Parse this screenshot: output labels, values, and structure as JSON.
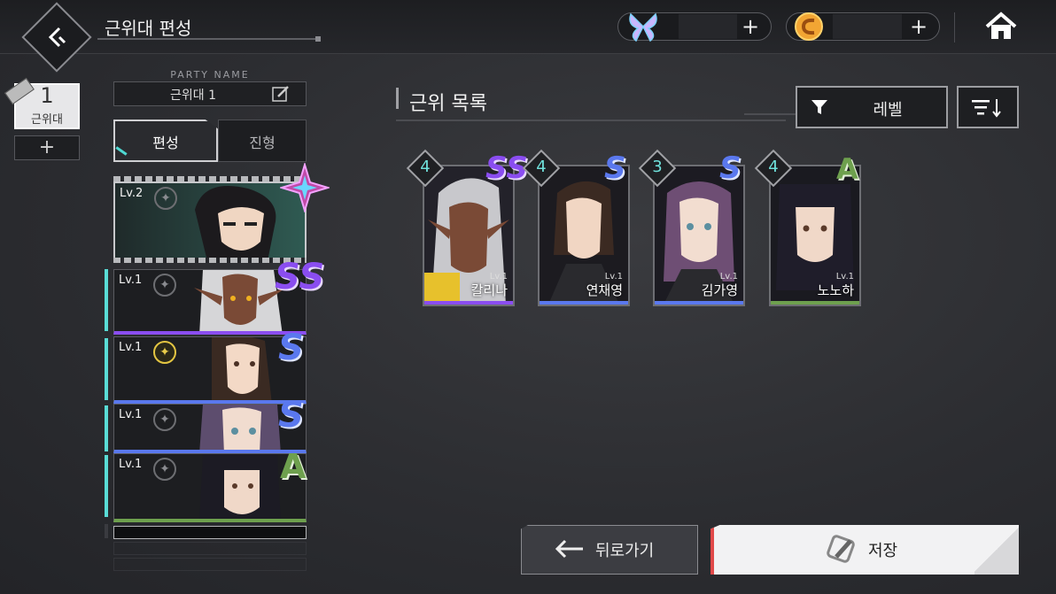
{
  "header": {
    "title": "근위대 편성"
  },
  "slots": {
    "active_number": "1",
    "active_label": "근위대",
    "add_label": "+"
  },
  "party": {
    "name_caption": "PARTY NAME",
    "name_value": "근위대 1",
    "tabs": [
      {
        "label": "편성",
        "active": true
      },
      {
        "label": "진형",
        "active": false
      }
    ],
    "members": [
      {
        "level": "Lv.2",
        "rank": ""
      },
      {
        "level": "Lv.1",
        "rank": "SS"
      },
      {
        "level": "Lv.1",
        "rank": "S"
      },
      {
        "level": "Lv.1",
        "rank": "S"
      },
      {
        "level": "Lv.1",
        "rank": "A"
      }
    ]
  },
  "list": {
    "title": "근위 목록",
    "filter_label": "레벨",
    "cards": [
      {
        "stars": "4",
        "rank": "SS",
        "level": "Lv.1",
        "name": "칼리나"
      },
      {
        "stars": "4",
        "rank": "S",
        "level": "Lv.1",
        "name": "연채영"
      },
      {
        "stars": "3",
        "rank": "S",
        "level": "Lv.1",
        "name": "김가영"
      },
      {
        "stars": "4",
        "rank": "A",
        "level": "Lv.1",
        "name": "노노하"
      }
    ]
  },
  "buttons": {
    "back_label": "뒤로가기",
    "save_label": "저장"
  },
  "icons": {
    "back": "back-arrow-icon",
    "currency1": "butterfly-crystal-icon",
    "currency2": "gold-coin-icon",
    "home": "home-icon",
    "edit": "edit-icon",
    "filter": "filter-icon",
    "sort": "sort-icon",
    "save": "save-icon"
  },
  "colors": {
    "accent_cyan": "#59dcd6",
    "rank_ss": "#8a4df0",
    "rank_s": "#5a78ee",
    "rank_a": "#6ea04e",
    "save_accent": "#e24a4a"
  }
}
